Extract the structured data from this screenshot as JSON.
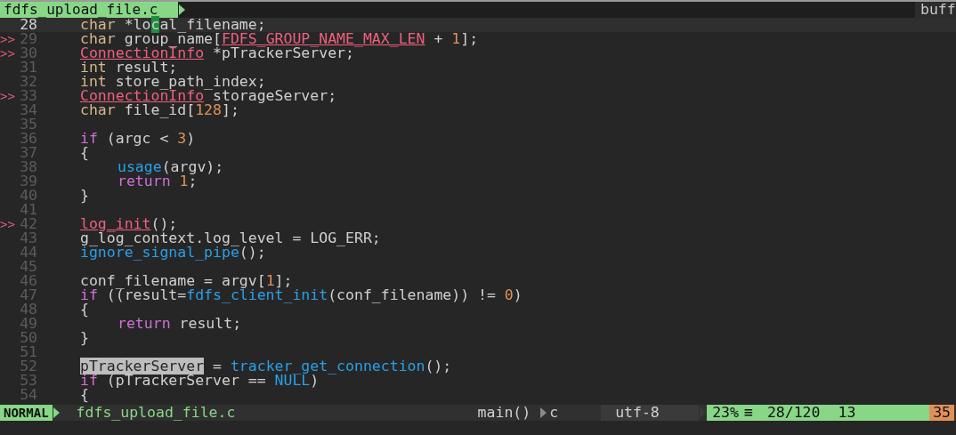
{
  "tabline": {
    "tabs": [
      {
        "label": "fdfs_upload_file.c",
        "selected": true
      }
    ],
    "right_label": "buff"
  },
  "lines": [
    {
      "n": "28",
      "current": true,
      "code": [
        {
          "kind": "type",
          "t": "char"
        },
        {
          "kind": "plain",
          "t": " *lo"
        },
        {
          "kind": "cursor",
          "t": "c"
        },
        {
          "kind": "plain",
          "t": "al_filename;"
        }
      ]
    },
    {
      "n": "29",
      "sign": ">>",
      "current": false,
      "code": [
        {
          "kind": "type",
          "t": "char"
        },
        {
          "kind": "plain",
          "t": " group_name["
        },
        {
          "kind": "error",
          "t": "FDFS_GROUP_NAME_MAX_LEN"
        },
        {
          "kind": "plain",
          "t": " + "
        },
        {
          "kind": "number",
          "t": "1"
        },
        {
          "kind": "plain",
          "t": "];"
        }
      ]
    },
    {
      "n": "30",
      "sign": ">>",
      "current": false,
      "code": [
        {
          "kind": "error",
          "t": "ConnectionInfo"
        },
        {
          "kind": "plain",
          "t": " *pTrackerServer;"
        }
      ]
    },
    {
      "n": "31",
      "current": false,
      "code": [
        {
          "kind": "type",
          "t": "int"
        },
        {
          "kind": "plain",
          "t": " result;"
        }
      ]
    },
    {
      "n": "32",
      "current": false,
      "code": [
        {
          "kind": "type",
          "t": "int"
        },
        {
          "kind": "plain",
          "t": " store_path_index;"
        }
      ]
    },
    {
      "n": "33",
      "sign": ">>",
      "current": false,
      "code": [
        {
          "kind": "error",
          "t": "ConnectionInfo"
        },
        {
          "kind": "plain",
          "t": " storageServer;"
        }
      ]
    },
    {
      "n": "34",
      "current": false,
      "code": [
        {
          "kind": "type",
          "t": "char"
        },
        {
          "kind": "plain",
          "t": " file_id["
        },
        {
          "kind": "number",
          "t": "128"
        },
        {
          "kind": "plain",
          "t": "];"
        }
      ]
    },
    {
      "n": "35",
      "current": false
    },
    {
      "n": "36",
      "current": false,
      "code": [
        {
          "kind": "keyword",
          "t": "if"
        },
        {
          "kind": "plain",
          "t": " (argc < "
        },
        {
          "kind": "number",
          "t": "3"
        },
        {
          "kind": "plain",
          "t": ")"
        }
      ]
    },
    {
      "n": "37",
      "current": false,
      "code": [
        {
          "kind": "plain",
          "t": "{"
        }
      ]
    },
    {
      "n": "38",
      "current": false,
      "kind": "nested",
      "code": [
        {
          "kind": "function",
          "t": "usage"
        },
        {
          "kind": "plain",
          "t": "(argv);"
        }
      ]
    },
    {
      "n": "39",
      "current": false,
      "kind": "nested",
      "code": [
        {
          "kind": "keyword",
          "t": "return"
        },
        {
          "kind": "number",
          "t": " 1"
        },
        {
          "kind": "plain",
          "t": ";"
        }
      ]
    },
    {
      "n": "40",
      "current": false,
      "code": [
        {
          "kind": "plain",
          "t": "}"
        }
      ]
    },
    {
      "n": "41",
      "current": false
    },
    {
      "n": "42",
      "sign": ">>",
      "current": false,
      "code": [
        {
          "kind": "error",
          "t": "log_init"
        },
        {
          "kind": "plain",
          "t": "();"
        }
      ]
    },
    {
      "n": "43",
      "current": false,
      "code": [
        {
          "kind": "plain",
          "t": "g_log_context.log_level = LOG_ERR;"
        }
      ]
    },
    {
      "n": "44",
      "current": false,
      "code": [
        {
          "kind": "function",
          "t": "ignore_signal_pipe"
        },
        {
          "kind": "plain",
          "t": "();"
        }
      ]
    },
    {
      "n": "45",
      "current": false
    },
    {
      "n": "46",
      "current": false,
      "code": [
        {
          "kind": "plain",
          "t": "conf_filename = argv["
        },
        {
          "kind": "number",
          "t": "1"
        },
        {
          "kind": "plain",
          "t": "];"
        }
      ]
    },
    {
      "n": "47",
      "current": false,
      "code": [
        {
          "kind": "keyword",
          "t": "if"
        },
        {
          "kind": "plain",
          "t": " ((result="
        },
        {
          "kind": "function",
          "t": "fdfs_client_init"
        },
        {
          "kind": "plain",
          "t": "(conf_filename)) != "
        },
        {
          "kind": "number",
          "t": "0"
        },
        {
          "kind": "plain",
          "t": ")"
        }
      ]
    },
    {
      "n": "48",
      "current": false,
      "code": [
        {
          "kind": "plain",
          "t": "{"
        }
      ]
    },
    {
      "n": "49",
      "current": false,
      "kind": "nested",
      "code": [
        {
          "kind": "keyword",
          "t": "return"
        },
        {
          "kind": "plain",
          "t": " result;"
        }
      ]
    },
    {
      "n": "50",
      "current": false,
      "code": [
        {
          "kind": "plain",
          "t": "}"
        }
      ]
    },
    {
      "n": "51",
      "current": false
    },
    {
      "n": "52",
      "current": false,
      "code": [
        {
          "kind": "search",
          "t": "pTrackerServer"
        },
        {
          "kind": "plain",
          "t": " = "
        },
        {
          "kind": "function",
          "t": "tracker_get_connection"
        },
        {
          "kind": "plain",
          "t": "();"
        }
      ]
    },
    {
      "n": "53",
      "current": false,
      "code": [
        {
          "kind": "keyword",
          "t": "if"
        },
        {
          "kind": "plain",
          "t": " (pTrackerServer == "
        },
        {
          "kind": "function",
          "t": "NULL"
        },
        {
          "kind": "plain",
          "t": ")"
        }
      ]
    },
    {
      "n": "54",
      "current": false,
      "code": [
        {
          "kind": "plain",
          "t": "{"
        }
      ]
    }
  ],
  "status_bar": {
    "mode": "NORMAL",
    "file": "fdfs_upload_file.c",
    "function": "main()",
    "filetype": "c",
    "encoding": "utf-8",
    "percent": "23%",
    "percent_icon": "≡",
    "position": "28/120",
    "column": "13",
    "column_2": "35"
  }
}
